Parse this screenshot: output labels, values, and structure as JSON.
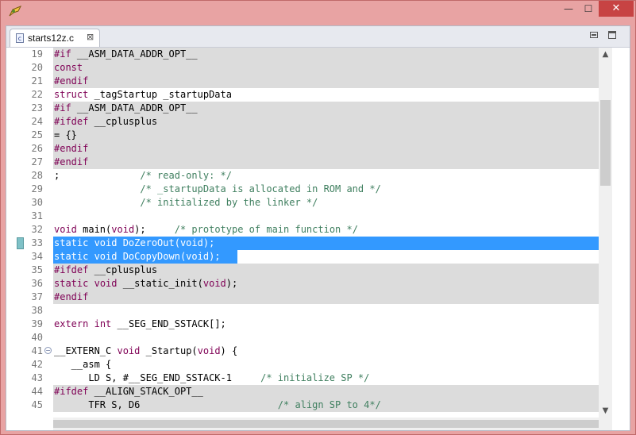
{
  "window": {
    "close_label": "✕",
    "minimize_label": "—",
    "maximize_label": "☐"
  },
  "tab": {
    "icon_letter": "c",
    "label": "starts12z.c",
    "close_label": "⊠"
  },
  "lines": [
    {
      "n": "19",
      "t": "#if __ASM_DATA_ADDR_OPT__"
    },
    {
      "n": "20",
      "t": "const"
    },
    {
      "n": "21",
      "t": "#endif"
    },
    {
      "n": "22",
      "t": "struct _tagStartup _startupData"
    },
    {
      "n": "23",
      "t": "#if __ASM_DATA_ADDR_OPT__"
    },
    {
      "n": "24",
      "t": "#ifdef __cplusplus"
    },
    {
      "n": "25",
      "t": "= {}"
    },
    {
      "n": "26",
      "t": "#endif"
    },
    {
      "n": "27",
      "t": "#endif"
    },
    {
      "n": "28",
      "t": ";              /* read-only: */"
    },
    {
      "n": "29",
      "t": "               /* _startupData is allocated in ROM and */"
    },
    {
      "n": "30",
      "t": "               /* initialized by the linker */"
    },
    {
      "n": "31",
      "t": ""
    },
    {
      "n": "32",
      "t": "void main(void);     /* prototype of main function */"
    },
    {
      "n": "33",
      "t": "static void DoZeroOut(void);"
    },
    {
      "n": "34",
      "t": "static void DoCopyDown(void);"
    },
    {
      "n": "35",
      "t": "#ifdef __cplusplus"
    },
    {
      "n": "36",
      "t": "static void __static_init(void);"
    },
    {
      "n": "37",
      "t": "#endif"
    },
    {
      "n": "38",
      "t": ""
    },
    {
      "n": "39",
      "t": "extern int __SEG_END_SSTACK[];"
    },
    {
      "n": "40",
      "t": ""
    },
    {
      "n": "41",
      "t": "__EXTERN_C void _Startup(void) {"
    },
    {
      "n": "42",
      "t": "   __asm {"
    },
    {
      "n": "43",
      "t": "      LD S, #__SEG_END_SSTACK-1     /* initialize SP */"
    },
    {
      "n": "44",
      "t": "#ifdef __ALIGN_STACK_OPT__"
    },
    {
      "n": "45",
      "t": "      TFR S, D6                        /* align SP to 4*/"
    }
  ],
  "scroll": {
    "up_label": "▲",
    "down_label": "▼"
  }
}
